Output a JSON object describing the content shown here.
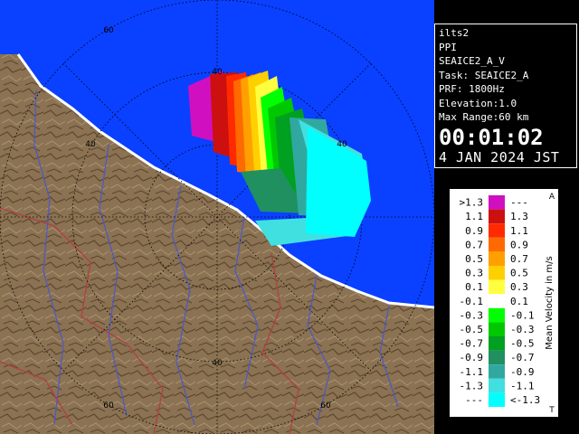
{
  "radar": {
    "range_ring_labels": [
      "60",
      "40",
      "40",
      "40",
      "40",
      "60",
      "60"
    ],
    "colors": {
      "sea": "#0a40ff",
      "land": "#8a7252",
      "land_dark": "#6b5238",
      "rings": "#000000",
      "rivers": "#4a58c8",
      "borders": "#b04040",
      "coast": "#ffffff"
    }
  },
  "info": {
    "site": "ilts2",
    "mode": "PPI",
    "product": "SEAICE2_A_V",
    "task": "Task: SEAICE2_A",
    "prf": "PRF: 1800Hz",
    "elevation": "Elevation:1.0",
    "max_range": "Max Range:60 km",
    "time": "00:01:02",
    "date": "4 JAN 2024 JST"
  },
  "legend": {
    "title": "Mean Velocity in m/s",
    "corner_top": "A",
    "corner_bottom": "T",
    "rows": [
      {
        "left": ">1.3",
        "right": "---",
        "color": "#d010c0"
      },
      {
        "left": "1.1",
        "right": "1.3",
        "color": "#cc1010"
      },
      {
        "left": "0.9",
        "right": "1.1",
        "color": "#ff2a00"
      },
      {
        "left": "0.7",
        "right": "0.9",
        "color": "#ff6a00"
      },
      {
        "left": "0.5",
        "right": "0.7",
        "color": "#ffa000"
      },
      {
        "left": "0.3",
        "right": "0.5",
        "color": "#ffd000"
      },
      {
        "left": "0.1",
        "right": "0.3",
        "color": "#ffff40"
      },
      {
        "left": "-0.1",
        "right": "0.1",
        "color": "#ffffff"
      },
      {
        "left": "-0.3",
        "right": "-0.1",
        "color": "#00ff00"
      },
      {
        "left": "-0.5",
        "right": "-0.3",
        "color": "#00c800"
      },
      {
        "left": "-0.7",
        "right": "-0.5",
        "color": "#00a020"
      },
      {
        "left": "-0.9",
        "right": "-0.7",
        "color": "#209060"
      },
      {
        "left": "-1.1",
        "right": "-0.9",
        "color": "#30a8a0"
      },
      {
        "left": "-1.3",
        "right": "-1.1",
        "color": "#40e0e0"
      },
      {
        "left": "---",
        "right": "<-1.3",
        "color": "#00ffff"
      }
    ]
  }
}
